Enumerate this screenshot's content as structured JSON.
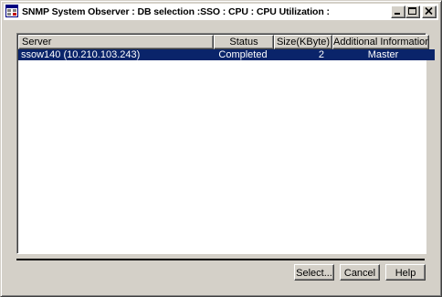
{
  "window": {
    "title": "SNMP System Observer : DB selection :SSO : CPU : CPU Utilization :"
  },
  "table": {
    "columns": [
      "Server",
      "Status",
      "Size(KByte)",
      "Additional Information"
    ],
    "rows": [
      {
        "server": "ssow140 (10.210.103.243)",
        "status": "Completed",
        "size": "2",
        "info": "Master",
        "selected": true
      }
    ]
  },
  "buttons": {
    "select": "Select...",
    "cancel": "Cancel",
    "help": "Help"
  },
  "colors": {
    "selection": "#0a246a",
    "face": "#d4d0c8"
  },
  "icons": {
    "app": "app-window-icon",
    "minimize": "minimize-icon",
    "maximize": "maximize-icon",
    "close": "close-icon"
  }
}
